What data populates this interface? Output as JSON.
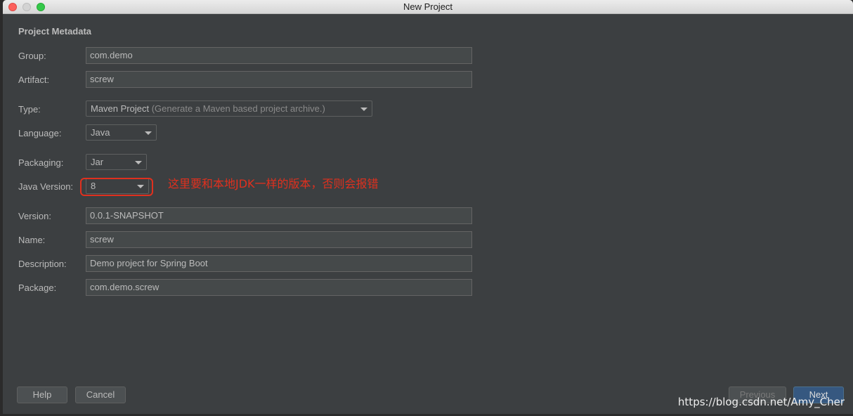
{
  "window": {
    "title": "New Project"
  },
  "section": {
    "title": "Project Metadata"
  },
  "form": {
    "group": {
      "label": "Group:",
      "value": "com.demo"
    },
    "artifact": {
      "label": "Artifact:",
      "value": "screw"
    },
    "type": {
      "label": "Type:",
      "value": "Maven Project",
      "hint": "(Generate a Maven based project archive.)"
    },
    "language": {
      "label": "Language:",
      "value": "Java"
    },
    "packaging": {
      "label": "Packaging:",
      "value": "Jar"
    },
    "java_version": {
      "label": "Java Version:",
      "value": "8"
    },
    "version": {
      "label": "Version:",
      "value": "0.0.1-SNAPSHOT"
    },
    "name": {
      "label": "Name:",
      "value": "screw"
    },
    "description": {
      "label": "Description:",
      "value": "Demo project for Spring Boot"
    },
    "package": {
      "label": "Package:",
      "value": "com.demo.screw"
    }
  },
  "annotation": {
    "text": "这里要和本地JDK一样的版本，否则会报错",
    "color": "#e0301e"
  },
  "buttons": {
    "help": "Help",
    "cancel": "Cancel",
    "previous": "Previous",
    "next": "Next"
  },
  "watermark": "https://blog.csdn.net/Amy_Cher",
  "colors": {
    "background": "#3c3f41",
    "accent": "#365880",
    "annotation": "#e0301e"
  }
}
